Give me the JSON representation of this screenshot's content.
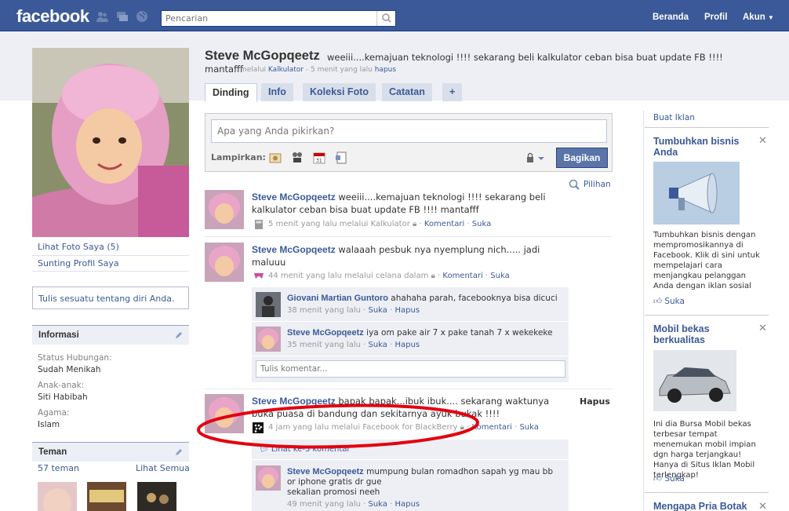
{
  "topbar": {
    "logo": "facebook",
    "search_placeholder": "Pencarian",
    "nav": [
      "Beranda",
      "Profil",
      "Akun"
    ]
  },
  "left": {
    "photo_link": "Lihat Foto Saya (5)",
    "edit_profile": "Sunting Profil Saya",
    "bio_placeholder": "Tulis sesuatu tentang diri Anda.",
    "info_title": "Informasi",
    "info": [
      {
        "label": "Status Hubungan:",
        "value": "Sudah Menikah"
      },
      {
        "label": "Anak-anak:",
        "value": "Siti Habibah"
      },
      {
        "label": "Agama:",
        "value": "Islam"
      }
    ],
    "friends_title": "Teman",
    "friends_count": "57 teman",
    "friends_all": "Lihat Semua"
  },
  "profile": {
    "name": "Steve McGopqeetz",
    "status_line1": "weeiii....kemajuan teknologi !!!! sekarang beli kalkulator ceban bisa buat update FB !!!!",
    "status_line2": "mantafff",
    "status_meta_prefix": "melalui",
    "status_meta_app": "Kalkulator",
    "status_meta_time": "- 5 menit yang lalu",
    "status_meta_delete": "hapus",
    "tabs": [
      "Dinding",
      "Info",
      "Koleksi Foto",
      "Catatan",
      "+"
    ]
  },
  "composer": {
    "placeholder": "Apa yang Anda pikirkan?",
    "attach_label": "Lampirkan:",
    "share_button": "Bagikan"
  },
  "options_link": "Pilihan",
  "stories": [
    {
      "actor": "Steve McGopqeetz",
      "text": "weeiii....kemajuan teknologi !!!! sekarang beli kalkulator ceban bisa buat update FB !!!! mantafff",
      "time": "5 menit yang lalu melalui Kalkulator",
      "comment": "Komentari",
      "like": "Suka"
    },
    {
      "actor": "Steve McGopqeetz",
      "text": "walaaah pesbuk nya nyemplung nich..... jadi maluuu",
      "time": "44 menit yang lalu melalui celana dalam",
      "comment": "Komentari",
      "like": "Suka",
      "comments": [
        {
          "actor": "Giovani Martian Guntoro",
          "text": "ahahaha parah, facebooknya bisa dicuci",
          "time": "38 menit yang lalu",
          "like": "Suka",
          "delete": "Hapus"
        },
        {
          "actor": "Steve McGopqeetz",
          "text": "iya om pake air 7 x pake tanah 7 x wekekeke",
          "time": "35 menit yang lalu",
          "like": "Suka",
          "delete": "Hapus"
        }
      ],
      "comment_placeholder": "Tulis komentar..."
    },
    {
      "actor": "Steve McGopqeetz",
      "text": "bapak bapak...ibuk ibuk.... sekarang waktunya buka puasa di bandung dan sekitarnya  ayuk bukak !!!!",
      "time": "4 jam yang lalu melalui Facebook for BlackBerry",
      "comment": "Komentari",
      "like": "Suka",
      "delete": "Hapus",
      "view_all": "Lihat ke-3 komentar",
      "comments": [
        {
          "actor": "Steve McGopqeetz",
          "text": "mumpung bulan romadhon sapah yg mau bb or iphone gratis dr gue",
          "text2": "sekalian promosi neeh",
          "time": "49 menit yang lalu",
          "like": "Suka",
          "delete": "Hapus"
        }
      ]
    }
  ],
  "ads": {
    "create": "Buat Iklan",
    "items": [
      {
        "title": "Tumbuhkan bisnis Anda",
        "body": "Tumbuhkan bisnis dengan mempromosikannya di Facebook. Klik di sini untuk mempelajari cara menjangkau pelanggan Anda dengan iklan sosial",
        "like": "Suka"
      },
      {
        "title": "Mobil bekas berkualitas",
        "body": "Ini dia Bursa Mobil bekas terbesar tempat menemukan mobil impian dgn harga terjangkau! Hanya di Situs Iklan Mobil terlengkap!",
        "like": "Suka"
      },
      {
        "title": "Mengapa Pria Botak"
      }
    ]
  },
  "colors": {
    "brand": "#3b5998",
    "marker": "#e3000f"
  }
}
